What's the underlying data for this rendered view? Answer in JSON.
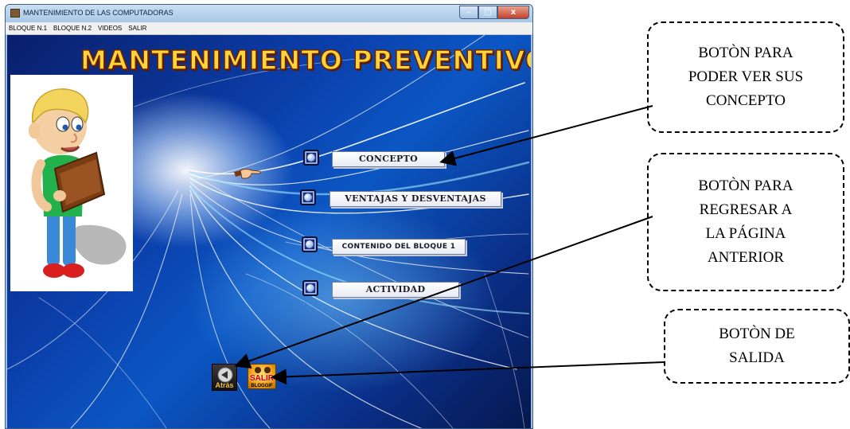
{
  "window": {
    "title": "MANTENIMIENTO DE LAS COMPUTADORAS",
    "controls": {
      "minimize": "–",
      "maximize": "□",
      "close": "x"
    }
  },
  "menubar": {
    "items": [
      "BLOQUE N.1",
      "BLOQUE N.2",
      "VIDEOS",
      "SALIR"
    ]
  },
  "content": {
    "main_title": "MANTENIMIENTO PREVENTIVO",
    "buttons": [
      {
        "label": "CONCEPTO"
      },
      {
        "label": "VENTAJAS  Y DESVENTAJAS"
      },
      {
        "label": "CONTENIDO DEL BLOQUE 1"
      },
      {
        "label": "ACTIVIDAD"
      }
    ],
    "back_icon": {
      "label": "Atrás",
      "icon": "back-arrow-icon"
    },
    "exit_icon": {
      "label": "SALIR",
      "sublabel": "BLOGGIF",
      "icon": "exit-icon"
    }
  },
  "callouts": [
    {
      "text": "BOTÒN PARA\nPODER VER SUS\nCONCEPTO"
    },
    {
      "text": "BOTÒN PARA\nREGRESAR A\nLA PÁGINA\nANTERIOR"
    },
    {
      "text": "BOTÒN DE\nSALIDA"
    }
  ],
  "colors": {
    "title_fill": "#ffd43a",
    "title_outline": "#6a2200",
    "background_blue": "#0b57c4",
    "callout_border": "#000000"
  }
}
